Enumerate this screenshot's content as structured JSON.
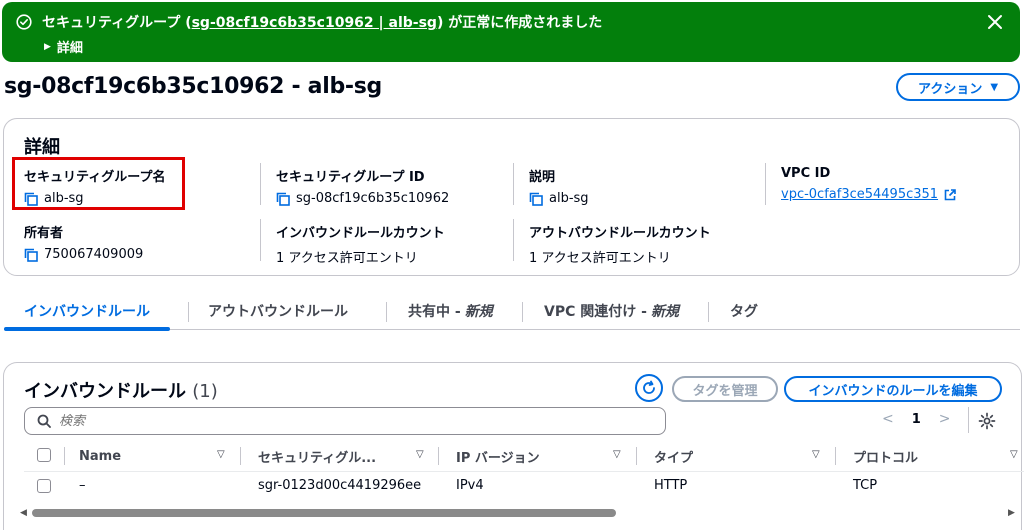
{
  "flash": {
    "prefix": "セキュリティグループ (",
    "link": "sg-08cf19c6b35c10962 | alb-sg",
    "suffix": ") が正常に作成されました",
    "detail": "詳細",
    "bg_color": "#037f0c"
  },
  "header": {
    "title": "sg-08cf19c6b35c10962 - alb-sg",
    "actions_label": "アクション"
  },
  "details": {
    "heading": "詳細",
    "fields": [
      {
        "label": "セキュリティグループ名",
        "value": "alb-sg"
      },
      {
        "label": "セキュリティグループ ID",
        "value": "sg-08cf19c6b35c10962"
      },
      {
        "label": "説明",
        "value": "alb-sg"
      },
      {
        "label": "VPC ID",
        "value": "vpc-0cfaf3ce54495c351"
      },
      {
        "label": "所有者",
        "value": "750067409009"
      },
      {
        "label": "インバウンドルールカウント",
        "value": "1 アクセス許可エントリ"
      },
      {
        "label": "アウトバウンドルールカウント",
        "value": "1 アクセス許可エントリ"
      }
    ]
  },
  "tabs": [
    {
      "label": "インバウンドルール",
      "badge": ""
    },
    {
      "label": "アウトバウンドルール",
      "badge": ""
    },
    {
      "label": "共有中 -",
      "badge": "新規"
    },
    {
      "label": "VPC 関連付け -",
      "badge": "新規"
    },
    {
      "label": "タグ",
      "badge": ""
    }
  ],
  "rules": {
    "title": "インバウンドルール",
    "count": "(1)",
    "manage_tags_label": "タグを管理",
    "edit_label": "インバウンドのルールを編集",
    "search_placeholder": "検索",
    "page": "1",
    "columns": [
      "Name",
      "セキュリティグル...",
      "IP バージョン",
      "タイプ",
      "プロトコル"
    ],
    "rows": [
      {
        "name": "–",
        "sgr_id": "sgr-0123d00c4419296ee",
        "ip_version": "IPv4",
        "type": "HTTP",
        "protocol": "TCP"
      }
    ]
  },
  "colors": {
    "accent": "#006ce0",
    "success": "#037f0c",
    "highlight": "#e00000"
  }
}
